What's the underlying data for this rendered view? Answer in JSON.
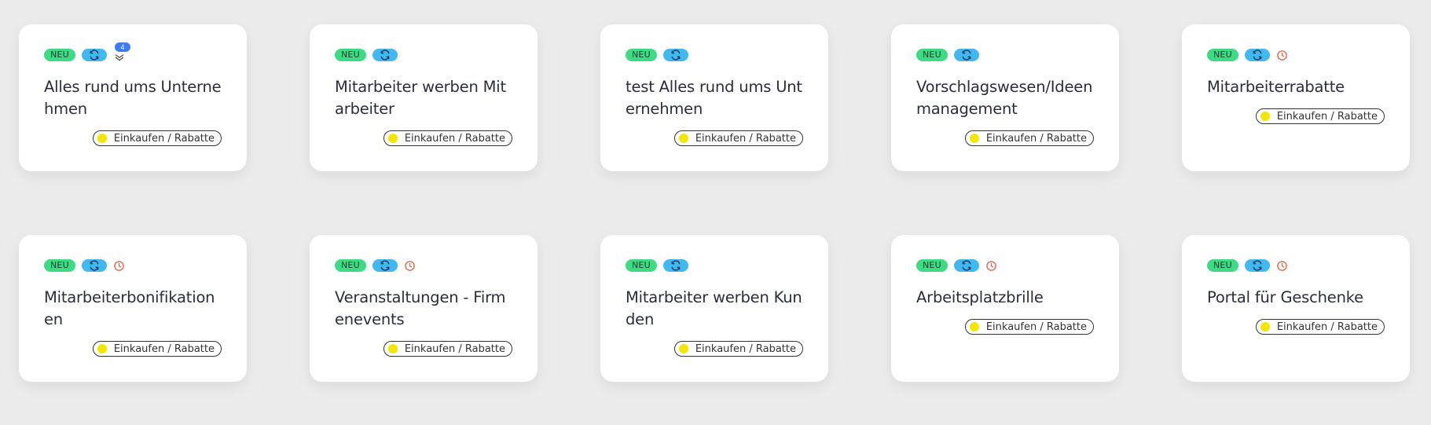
{
  "colors": {
    "neu_badge": "#3ddc84",
    "sync_badge": "#41b8f0",
    "clock": "#e8674a",
    "counter": "#3d7bf5",
    "category_dot": "#f4e600",
    "background": "#ececec"
  },
  "cards": [
    {
      "title": "Alles rund ums Unternehmen",
      "neu": "NEU",
      "category": "Einkaufen / Rabatte",
      "counter": "4",
      "icons": [
        "sync-icon",
        "layers-icon"
      ]
    },
    {
      "title": "Mitarbeiter werben Mitarbeiter",
      "neu": "NEU",
      "category": "Einkaufen / Rabatte",
      "icons": [
        "sync-icon"
      ]
    },
    {
      "title": "test Alles rund ums Unternehmen",
      "neu": "NEU",
      "category": "Einkaufen / Rabatte",
      "icons": [
        "sync-icon"
      ]
    },
    {
      "title": "Vorschlagswesen/Ideenmanagement",
      "neu": "NEU",
      "category": "Einkaufen / Rabatte",
      "icons": [
        "sync-icon"
      ]
    },
    {
      "title": "Mitarbeiterrabatte",
      "neu": "NEU",
      "category": "Einkaufen / Rabatte",
      "icons": [
        "sync-icon",
        "clock-icon"
      ]
    },
    {
      "title": "Mitarbeiterbonifikationen",
      "neu": "NEU",
      "category": "Einkaufen / Rabatte",
      "icons": [
        "sync-icon",
        "clock-icon"
      ]
    },
    {
      "title": "Veranstaltungen - Firmenevents",
      "neu": "NEU",
      "category": "Einkaufen / Rabatte",
      "icons": [
        "sync-icon",
        "clock-icon"
      ]
    },
    {
      "title": "Mitarbeiter werben Kunden",
      "neu": "NEU",
      "category": "Einkaufen / Rabatte",
      "icons": [
        "sync-icon"
      ]
    },
    {
      "title": "Arbeitsplatzbrille",
      "neu": "NEU",
      "category": "Einkaufen / Rabatte",
      "icons": [
        "sync-icon",
        "clock-icon"
      ]
    },
    {
      "title": "Portal für Geschenke",
      "neu": "NEU",
      "category": "Einkaufen / Rabatte",
      "icons": [
        "sync-icon",
        "clock-icon"
      ]
    }
  ]
}
